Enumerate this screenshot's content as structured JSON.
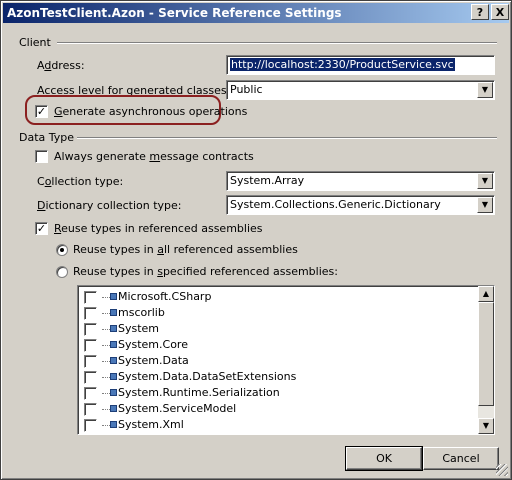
{
  "window": {
    "title": "AzonTestClient.Azon - Service Reference Settings",
    "help_glyph": "?",
    "close_glyph": "X"
  },
  "client": {
    "group_label": "Client",
    "address_label_pre": "A",
    "address_label_ul": "d",
    "address_label_post": "dress:",
    "address_value": "http://localhost:2330/ProductService.svc",
    "access_label_pre": "Access level for generated ",
    "access_label_ul": "c",
    "access_label_post": "lasses:",
    "access_value": "Public",
    "async_label_pre": "",
    "async_label_ul": "G",
    "async_label_post": "enerate asynchronous operations",
    "async_checked": true
  },
  "data_type": {
    "group_label": "Data Type",
    "always_label_pre": "Always generate ",
    "always_label_ul": "m",
    "always_label_post": "essage contracts",
    "always_checked": false,
    "collection_label_pre": "C",
    "collection_label_ul": "o",
    "collection_label_post": "llection type:",
    "collection_value": "System.Array",
    "dictionary_label_pre": "",
    "dictionary_label_ul": "D",
    "dictionary_label_post": "ictionary collection type:",
    "dictionary_value": "System.Collections.Generic.Dictionary",
    "reuse_label_pre": "",
    "reuse_label_ul": "R",
    "reuse_label_post": "euse types in referenced assemblies",
    "reuse_checked": true,
    "reuse_all_pre": "Reuse types in ",
    "reuse_all_ul": "a",
    "reuse_all_post": "ll referenced assemblies",
    "reuse_all_selected": true,
    "reuse_specified_pre": "Reuse types in ",
    "reuse_specified_ul": "s",
    "reuse_specified_post": "pecified referenced assemblies:",
    "reuse_specified_selected": false
  },
  "assemblies": [
    {
      "name": "Microsoft.CSharp",
      "checked": false
    },
    {
      "name": "mscorlib",
      "checked": false
    },
    {
      "name": "System",
      "checked": false
    },
    {
      "name": "System.Core",
      "checked": false
    },
    {
      "name": "System.Data",
      "checked": false
    },
    {
      "name": "System.Data.DataSetExtensions",
      "checked": false
    },
    {
      "name": "System.Runtime.Serialization",
      "checked": false
    },
    {
      "name": "System.ServiceModel",
      "checked": false
    },
    {
      "name": "System.Xml",
      "checked": false
    }
  ],
  "buttons": {
    "ok": "OK",
    "cancel": "Cancel"
  },
  "glyphs": {
    "check": "✓",
    "dropdown": "▼",
    "scroll_up": "▲",
    "scroll_down": "▼"
  },
  "colors": {
    "title_start": "#0a246a",
    "title_end": "#a6caf0",
    "highlight_oval": "#8b2020",
    "selection": "#0a246a"
  }
}
